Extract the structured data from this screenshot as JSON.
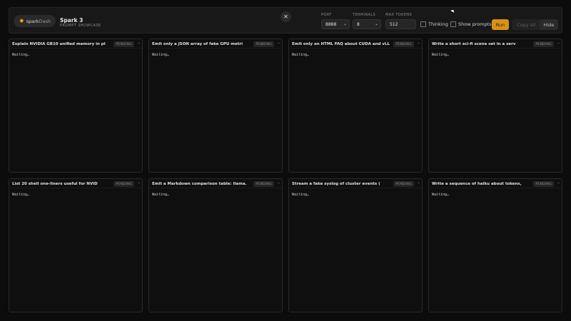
{
  "brand": {
    "name_prefix": "spark",
    "name_suffix": "Dash",
    "icon": "spark-icon"
  },
  "app": {
    "title": "Spark 3",
    "subtitle": "PROMPT SHOWCASE"
  },
  "toolbar": {
    "close_icon": "close-icon",
    "port": {
      "label": "PORT",
      "value": "8888"
    },
    "terminals": {
      "label": "TERMINALS",
      "value": "8"
    },
    "max_tokens": {
      "label": "MAX TOKENS",
      "value": "512"
    },
    "thinking_label": "Thinking",
    "show_prompts_label": "Show prompts",
    "run_label": "Run",
    "copy_all_label": "Copy all",
    "hide_label": "Hide"
  },
  "panels": [
    {
      "title": "Explain NVIDIA GB10 unified memory in pl",
      "status": "PENDING",
      "body": "Waiting…"
    },
    {
      "title": "Emit only a JSON array of fake GPU metri",
      "status": "PENDING",
      "body": "Waiting…"
    },
    {
      "title": "Emit only an HTML FAQ about CUDA and vLL",
      "status": "PENDING",
      "body": "Waiting…"
    },
    {
      "title": "Write a short sci-fi scene set in a serv",
      "status": "PENDING",
      "body": "Waiting…"
    },
    {
      "title": "List 20 shell one-liners useful for NVID",
      "status": "PENDING",
      "body": "Waiting…"
    },
    {
      "title": "Emit a Markdown comparison table: llama.",
      "status": "PENDING",
      "body": "Waiting…"
    },
    {
      "title": "Stream a fake syslog of cluster events (",
      "status": "PENDING",
      "body": "Waiting…"
    },
    {
      "title": "Write a sequence of haiku about tokens,",
      "status": "PENDING",
      "body": "Waiting…"
    }
  ],
  "panel_min_icon": "minimize-icon"
}
